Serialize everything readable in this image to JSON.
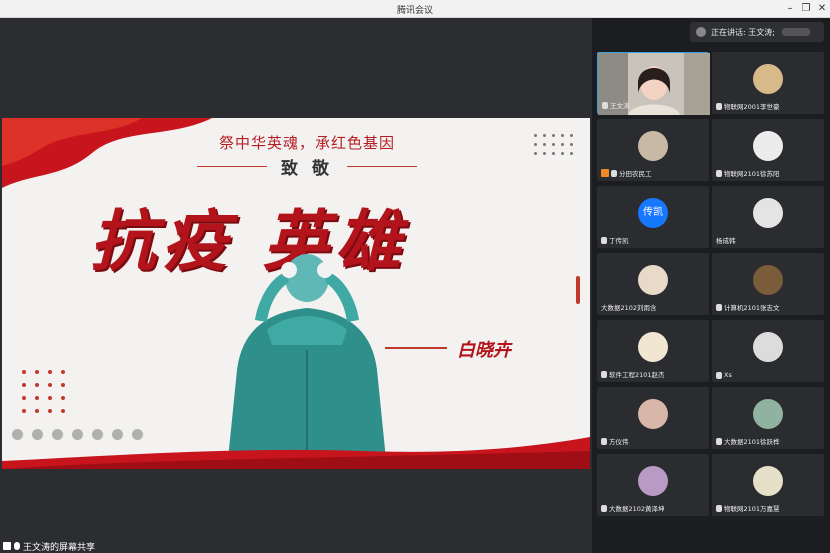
{
  "window": {
    "title": "腾讯会议"
  },
  "slide": {
    "headline": "祭中华英魂，承红色基因",
    "subhead": "致 敬",
    "title": "抗疫 英雄",
    "author": "白晓卉"
  },
  "share": {
    "label": "王文涛的屏幕共享"
  },
  "speaking": {
    "prefix": "正在讲话: 王文涛;"
  },
  "participants": [
    {
      "name": "王文涛",
      "type": "video",
      "mic": true
    },
    {
      "name": "物联网2001李世豪",
      "type": "avatar",
      "color": "#d8b98a",
      "mic": true
    },
    {
      "name": "分田农民工",
      "type": "avatar",
      "color": "#c8b9a6",
      "flag": true,
      "mic": true
    },
    {
      "name": "物联网2101徐苏阳",
      "type": "avatar",
      "color": "#ececec",
      "mic": true
    },
    {
      "name": "丁传凯",
      "type": "text",
      "avatar_text": "传凯",
      "color": "#1677ff",
      "mic": true
    },
    {
      "name": "杨成韩",
      "type": "avatar",
      "color": "#e4e4e4",
      "mic": false
    },
    {
      "name": "大数据2102刘雨含",
      "type": "avatar",
      "color": "#e8d9c8",
      "mic": false
    },
    {
      "name": "计算机2101张志文",
      "type": "avatar",
      "color": "#7a5b3a",
      "mic": true
    },
    {
      "name": "软件工程2101赵杰",
      "type": "avatar",
      "color": "#f1e6d2",
      "mic": true
    },
    {
      "name": "Xs",
      "type": "avatar",
      "color": "#dcdcdc",
      "mic": true
    },
    {
      "name": "方仪伟",
      "type": "avatar",
      "color": "#d9b7a8",
      "mic": true
    },
    {
      "name": "大数据2101徐跃桦",
      "type": "avatar",
      "color": "#8fb3a0",
      "mic": true
    },
    {
      "name": "大数据2102黄泽坤",
      "type": "avatar",
      "color": "#b89ac4",
      "mic": true
    },
    {
      "name": "物联网2101万嘉慧",
      "type": "avatar",
      "color": "#e7e0c8",
      "mic": true
    }
  ]
}
